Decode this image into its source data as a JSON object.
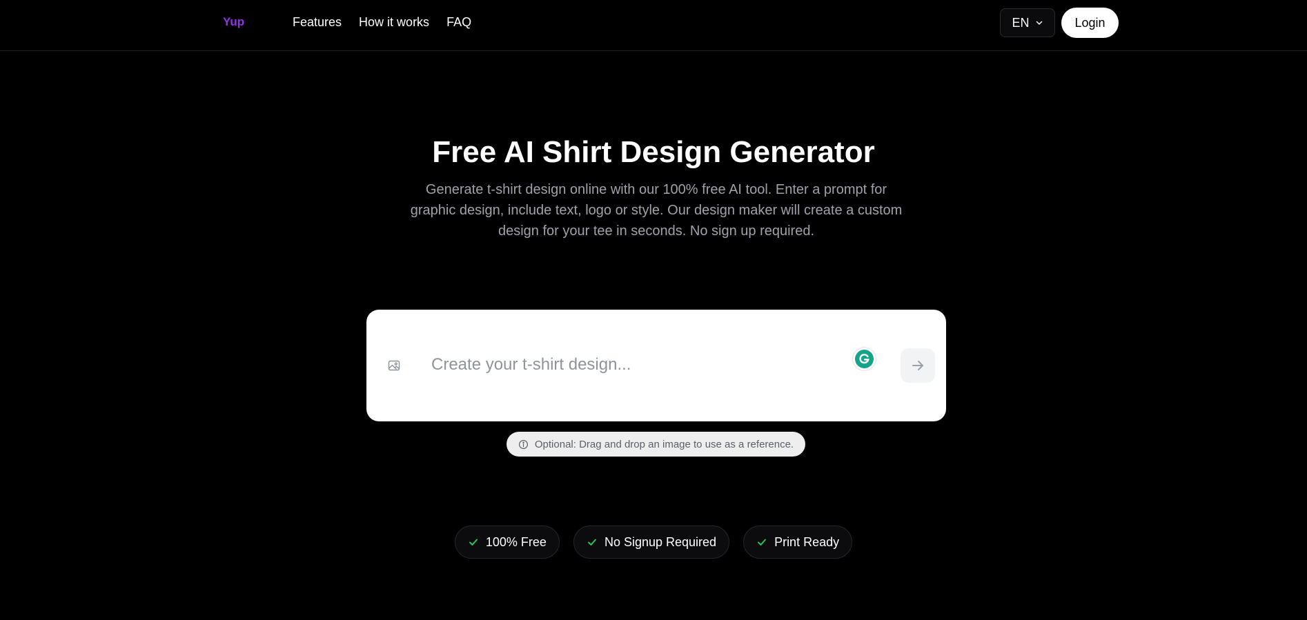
{
  "brand": {
    "logo_text": "Yup",
    "logo_color": "#9333ea"
  },
  "nav": {
    "links": [
      "Features",
      "How it works",
      "FAQ"
    ],
    "language": "EN",
    "login_label": "Login"
  },
  "hero": {
    "title": "Free AI Shirt Design Generator",
    "subtitle": "Generate t-shirt design online with our 100% free AI tool. Enter a prompt for graphic design, include text, logo or style. Our design maker will create a custom design for your tee in seconds. No sign up required."
  },
  "prompt": {
    "placeholder": "Create your t-shirt design...",
    "value": "",
    "icons": [
      "image-icon",
      "grammarly-icon",
      "arrow-right-icon"
    ]
  },
  "hint": {
    "icon": "info-icon",
    "text": "Optional: Drag and drop an image to use as a reference."
  },
  "badges": [
    {
      "icon": "check-icon",
      "label": "100% Free"
    },
    {
      "icon": "check-icon",
      "label": "No Signup Required"
    },
    {
      "icon": "check-icon",
      "label": "Print Ready"
    }
  ],
  "colors": {
    "background": "#000000",
    "check_green": "#22c55e",
    "grammarly_green": "#15a38a",
    "subtitle_gray": "#a1a1aa"
  }
}
